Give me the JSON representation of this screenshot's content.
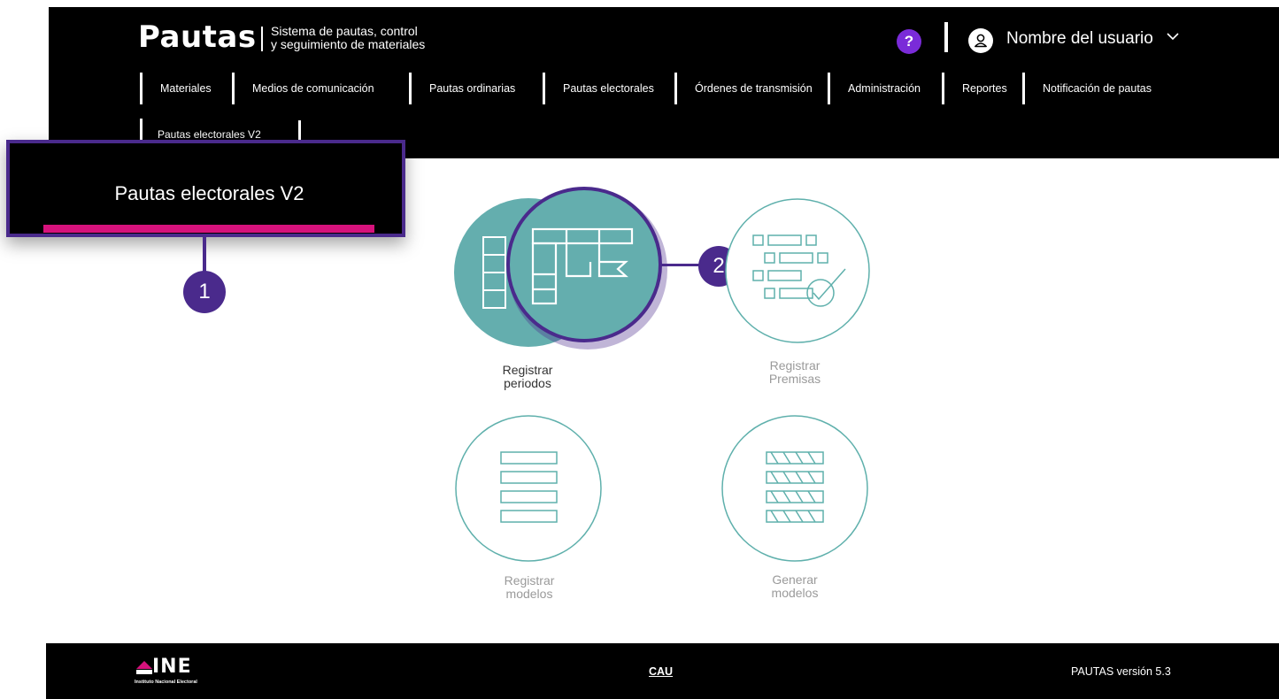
{
  "header": {
    "logo": "Pautas",
    "tagline_line1": "Sistema de pautas, control",
    "tagline_line2": "y seguimiento de materiales",
    "help_label": "?",
    "user_name": "Nombre del usuario"
  },
  "nav": {
    "items": [
      {
        "label": "Materiales"
      },
      {
        "label": "Medios de comunicación"
      },
      {
        "label": "Pautas ordinarias"
      },
      {
        "label": "Pautas electorales"
      },
      {
        "label": "Órdenes de transmisión"
      },
      {
        "label": "Administración"
      },
      {
        "label": "Reportes"
      },
      {
        "label": "Notificación de pautas"
      },
      {
        "label": "Pautas electorales V2"
      }
    ]
  },
  "callouts": {
    "first": {
      "text": "Pautas electorales V2",
      "number": "1"
    },
    "second": {
      "number": "2"
    }
  },
  "tiles": [
    {
      "line1": "Registrar",
      "line2": "periodos",
      "state": "active",
      "icon": "calendar-grid-icon"
    },
    {
      "line1": "Registrar",
      "line2": "Premisas",
      "state": "inactive",
      "icon": "checklist-icon"
    },
    {
      "line1": "Registrar",
      "line2": "modelos",
      "state": "inactive",
      "icon": "list-rows-icon"
    },
    {
      "line1": "Generar",
      "line2": "modelos",
      "state": "inactive",
      "icon": "hatched-rows-icon"
    }
  ],
  "footer": {
    "logo_word": "INE",
    "logo_sub": "Instituto Nacional Electoral",
    "link": "CAU",
    "version": "PAUTAS versión 5.3"
  },
  "colors": {
    "teal": "#64aeae",
    "teal_line": "#5fb0ac",
    "purple": "#4a2a8c",
    "magenta": "#d6127c",
    "help": "#7a2bd8"
  }
}
